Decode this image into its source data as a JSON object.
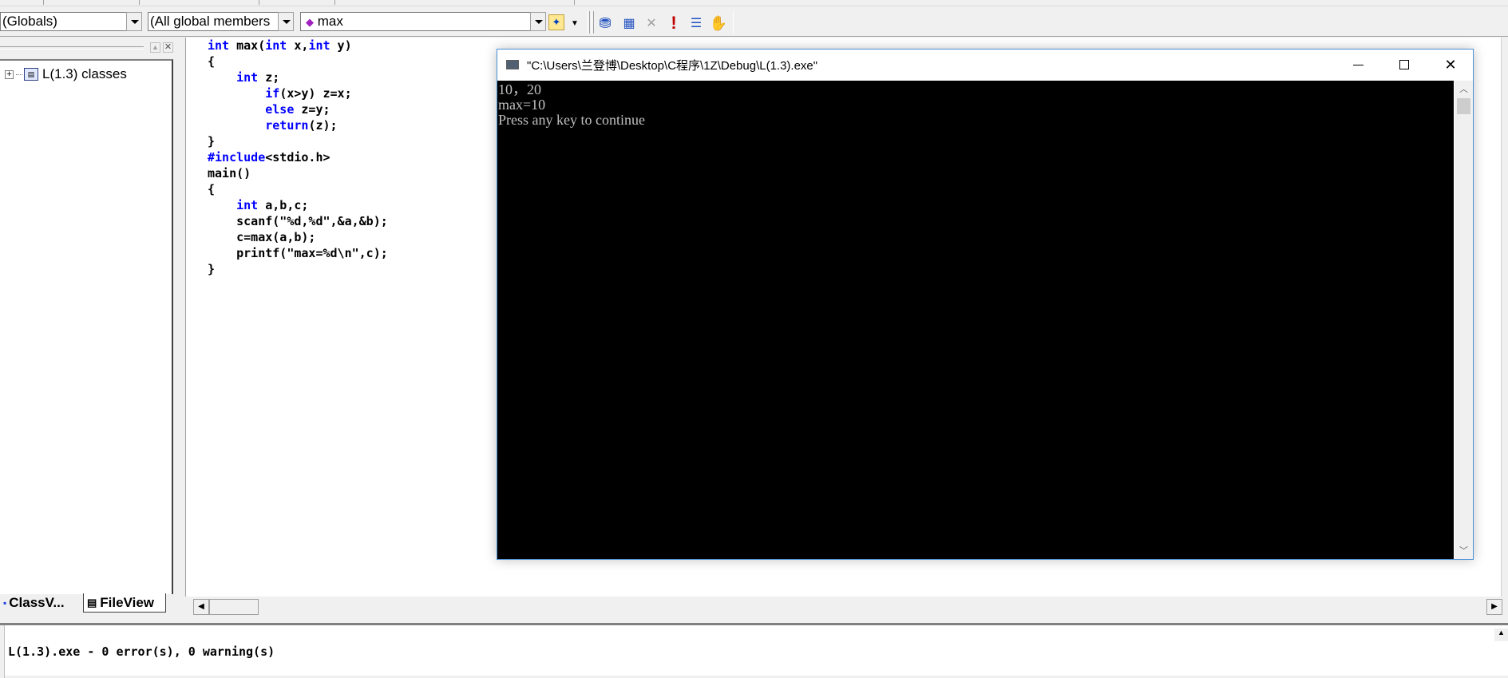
{
  "toolbar": {
    "scope_combo": "(Globals)",
    "members_combo": "(All global members",
    "function_combo": "max",
    "icons": [
      "wizard-icon",
      "compile-icon",
      "build-icon",
      "stop-build-icon",
      "execute-icon",
      "step-icon",
      "go-icon"
    ]
  },
  "class_view": {
    "tree_root": "L(1.3) classes",
    "tabs": [
      "ClassV...",
      "FileView"
    ]
  },
  "editor": {
    "code_lines": [
      [
        {
          "k": true,
          "t": "int"
        },
        {
          "t": " max("
        },
        {
          "k": true,
          "t": "int"
        },
        {
          "t": " x,"
        },
        {
          "k": true,
          "t": "int"
        },
        {
          "t": " y)"
        }
      ],
      [
        {
          "t": "{"
        }
      ],
      [
        {
          "t": "    "
        },
        {
          "k": true,
          "t": "int"
        },
        {
          "t": " z;"
        }
      ],
      [
        {
          "t": "        "
        },
        {
          "k": true,
          "t": "if"
        },
        {
          "t": "(x>y) z=x;"
        }
      ],
      [
        {
          "t": "        "
        },
        {
          "k": true,
          "t": "else"
        },
        {
          "t": " z=y;"
        }
      ],
      [
        {
          "t": "        "
        },
        {
          "k": true,
          "t": "return"
        },
        {
          "t": "(z);"
        }
      ],
      [
        {
          "t": "}"
        }
      ],
      [
        {
          "k": true,
          "t": "#include"
        },
        {
          "t": "<stdio.h>"
        }
      ],
      [
        {
          "t": "main()"
        }
      ],
      [
        {
          "t": "{"
        }
      ],
      [
        {
          "t": "    "
        },
        {
          "k": true,
          "t": "int"
        },
        {
          "t": " a,b,c;"
        }
      ],
      [
        {
          "t": "    scanf(\"%d,%d\",&a,&b);"
        }
      ],
      [
        {
          "t": "    c=max(a,b);"
        }
      ],
      [
        {
          "t": "    printf(\"max=%d\\n\",c);"
        }
      ],
      [
        {
          "t": "}"
        }
      ]
    ],
    "keyword_color": "#0000ff"
  },
  "console": {
    "title": "\"C:\\Users\\兰登博\\Desktop\\C程序\\1Z\\Debug\\L(1.3).exe\"",
    "output": "10，20\nmax=10\nPress any key to continue"
  },
  "output_pane": {
    "text": "L(1.3).exe - 0 error(s), 0 warning(s)"
  }
}
